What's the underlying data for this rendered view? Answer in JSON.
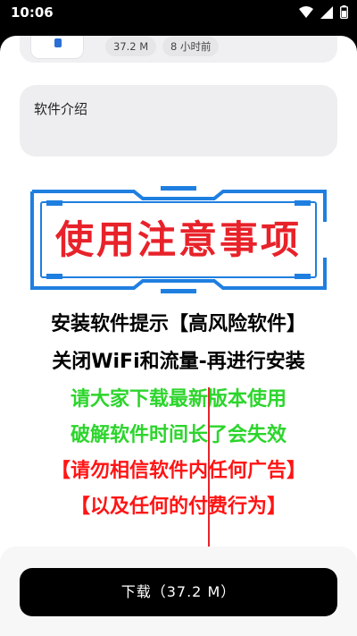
{
  "status_bar": {
    "time": "10:06",
    "icons": [
      "wifi-icon",
      "signal-icon",
      "battery-icon"
    ]
  },
  "app_info": {
    "size_chip": "37.2 M",
    "time_chip": "8 小时前"
  },
  "intro": {
    "title": "软件介绍"
  },
  "promo": {
    "frame_title": "使用注意事项",
    "lines": [
      "安装软件提示【高风险软件】",
      "关闭WiFi和流量-再进行安装",
      "请大家下载最新版本使用",
      "破解软件时间长了会失效",
      "【请勿相信软件内任何广告】",
      "【以及任何的付费行为】"
    ],
    "colors": {
      "frame_title": "#e8222a",
      "black_lines": "#000000",
      "green_lines": "#2cd52c",
      "red_lines": "#ff1414",
      "frame_blue": "#1f7fe0"
    }
  },
  "download": {
    "label": "下载（37.2 M）"
  }
}
